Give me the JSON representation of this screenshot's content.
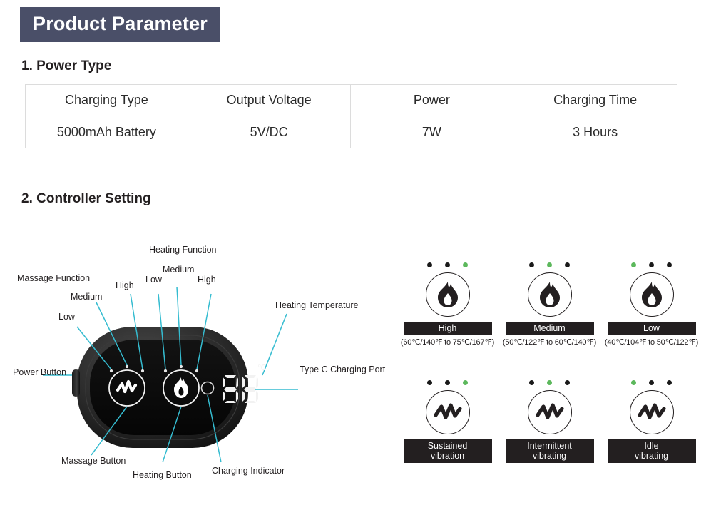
{
  "header": {
    "title": "Product Parameter",
    "bg_color": "#4a4f68"
  },
  "sections": {
    "power_type": {
      "number_title": "1. Power Type"
    },
    "controller": {
      "number_title": "2. Controller Setting"
    }
  },
  "power_table": {
    "headers": [
      "Charging Type",
      "Output Voltage",
      "Power",
      "Charging Time"
    ],
    "values": [
      "5000mAh Battery",
      "5V/DC",
      "7W",
      "3 Hours"
    ]
  },
  "controller": {
    "display_value": "88",
    "display_unit": "℃",
    "callouts": {
      "massage_function": "Massage Function",
      "massage_low": "Low",
      "massage_medium": "Medium",
      "massage_high": "High",
      "heating_function": "Heating Function",
      "heating_low": "Low",
      "heating_medium": "Medium",
      "heating_high": "High",
      "heating_temperature": "Heating Temperature",
      "type_c_port": "Type C Charging Port",
      "power_button": "Power Button",
      "massage_button": "Massage Button",
      "heating_button": "Heating Button",
      "charging_indicator": "Charging Indicator"
    },
    "leader_color": "#35bcd0"
  },
  "heating_modes": [
    {
      "label": "High",
      "active_index": 2,
      "range": "(60℃/140℉ to 75℃/167℉)"
    },
    {
      "label": "Medium",
      "active_index": 1,
      "range": "(50℃/122℉ to 60℃/140℉)"
    },
    {
      "label": "Low",
      "active_index": 0,
      "range": "(40℃/104℉ to 50℃/122℉)"
    }
  ],
  "vibration_modes": [
    {
      "label_line1": "Sustained",
      "label_line2": "vibration",
      "active_index": 2
    },
    {
      "label_line1": "Intermittent",
      "label_line2": "vibrating",
      "active_index": 1
    },
    {
      "label_line1": "Idle",
      "label_line2": "vibrating",
      "active_index": 0
    }
  ],
  "colors": {
    "active_dot": "#5cb85c",
    "inactive_dot": "#1a1a1a",
    "dark": "#231f20"
  }
}
